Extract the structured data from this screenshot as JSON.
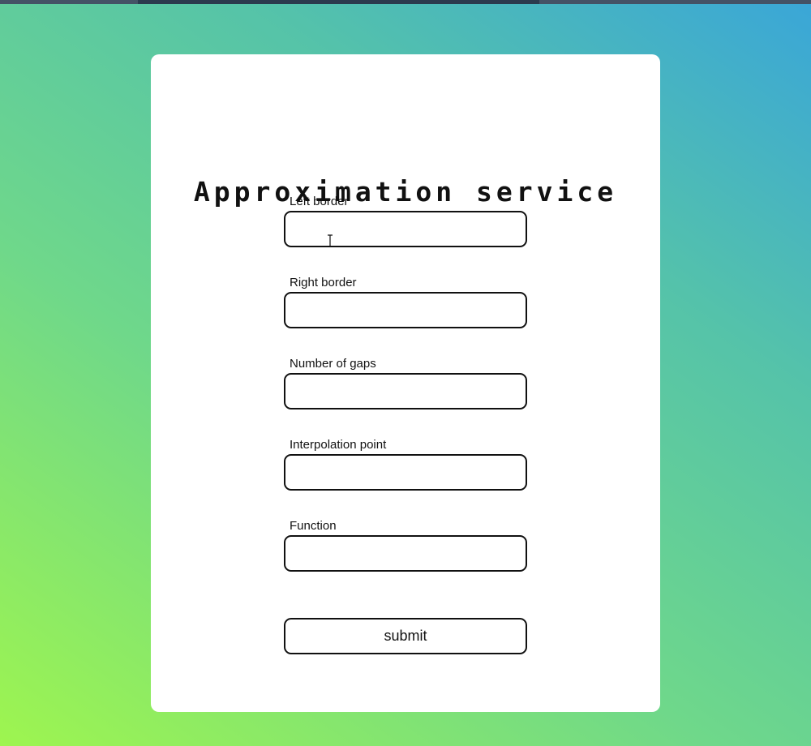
{
  "form": {
    "title": "Approximation service",
    "fields": [
      {
        "label": "Left border",
        "value": "",
        "placeholder": ""
      },
      {
        "label": "Right border",
        "value": "",
        "placeholder": ""
      },
      {
        "label": "Number of gaps",
        "value": "",
        "placeholder": ""
      },
      {
        "label": "Interpolation point",
        "value": "",
        "placeholder": ""
      },
      {
        "label": "Function",
        "value": "",
        "placeholder": ""
      }
    ],
    "submit_label": "submit"
  },
  "icons": {
    "cursor": "text-cursor-icon"
  },
  "colors": {
    "gradient_start": "#9ef54f",
    "gradient_end": "#3aa6d8",
    "card_background": "#ffffff",
    "border": "#111111"
  }
}
